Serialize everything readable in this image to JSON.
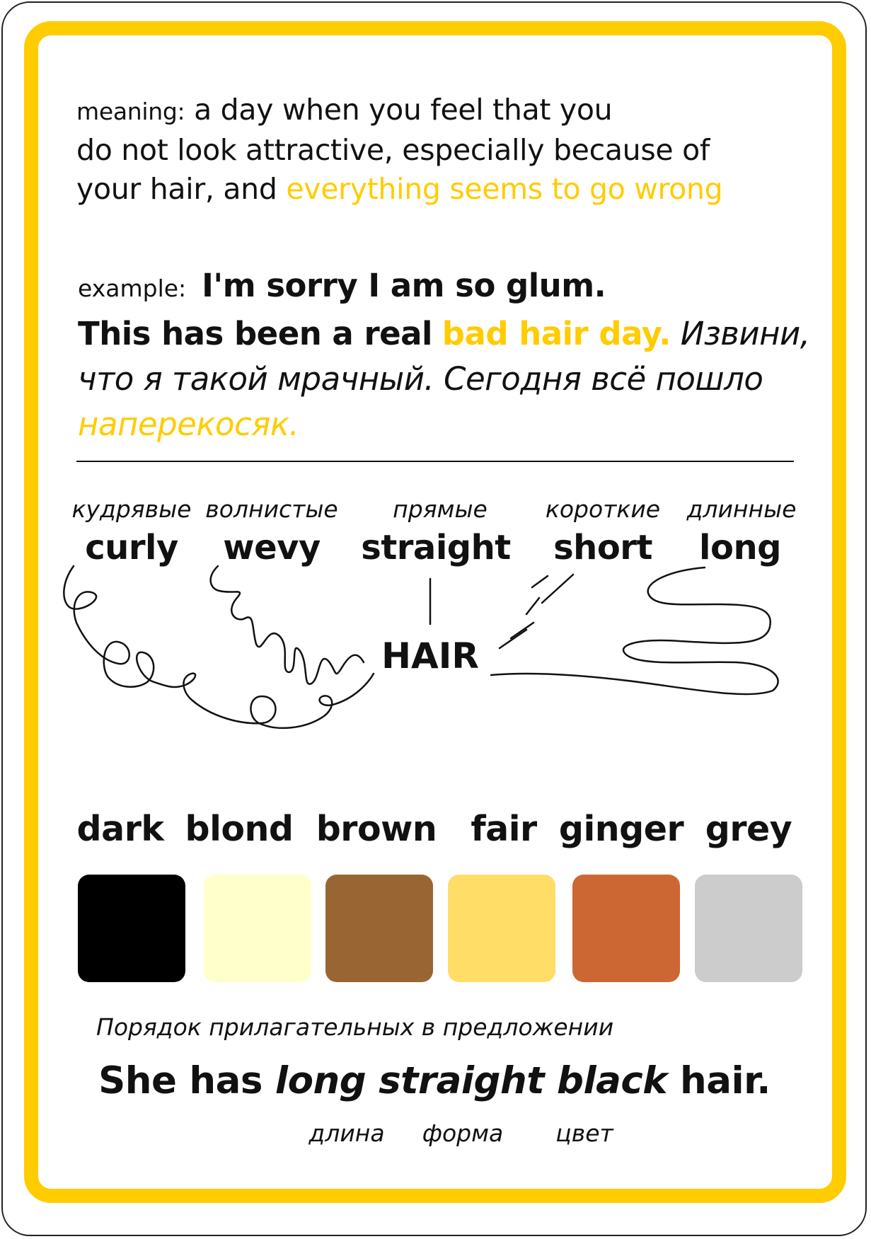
{
  "meaning": {
    "label": "meaning:",
    "text_part1": "a day when you feel that you",
    "text_part2": "do not look attractive, especially because of",
    "text_part3": "your hair, and",
    "highlight": "everything seems to go wrong"
  },
  "example": {
    "label": "example:",
    "en_part1": "I'm sorry I am so glum.",
    "en_part2": "This has been a real",
    "en_highlight": "bad hair day.",
    "ru_part1": "Извини,",
    "ru_part2": "что я такой мрачный. Сегодня всё пошло",
    "ru_highlight": "наперекосяк."
  },
  "hair_types": [
    {
      "ru": "кудрявые",
      "en": "curly"
    },
    {
      "ru": "волнистые",
      "en": "wevy"
    },
    {
      "ru": "прямые",
      "en": "straight"
    },
    {
      "ru": "короткие",
      "en": "short"
    },
    {
      "ru": "длинные",
      "en": "long"
    }
  ],
  "hair_center": "HAIR",
  "colors": [
    {
      "name": "dark",
      "hex": "#000000"
    },
    {
      "name": "blond",
      "hex": "#ffffcc"
    },
    {
      "name": "brown",
      "hex": "#996633"
    },
    {
      "name": "fair",
      "hex": "#ffdd66"
    },
    {
      "name": "ginger",
      "hex": "#cc6633"
    },
    {
      "name": "grey",
      "hex": "#cccccc"
    }
  ],
  "order": {
    "title": "Порядок прилагательных в предложении",
    "sentence_start": "She has",
    "sentence_italic": "long straight black",
    "sentence_end": "hair.",
    "labels": [
      "длина",
      "форма",
      "цвет"
    ]
  },
  "accent_color": "#ffcc00"
}
